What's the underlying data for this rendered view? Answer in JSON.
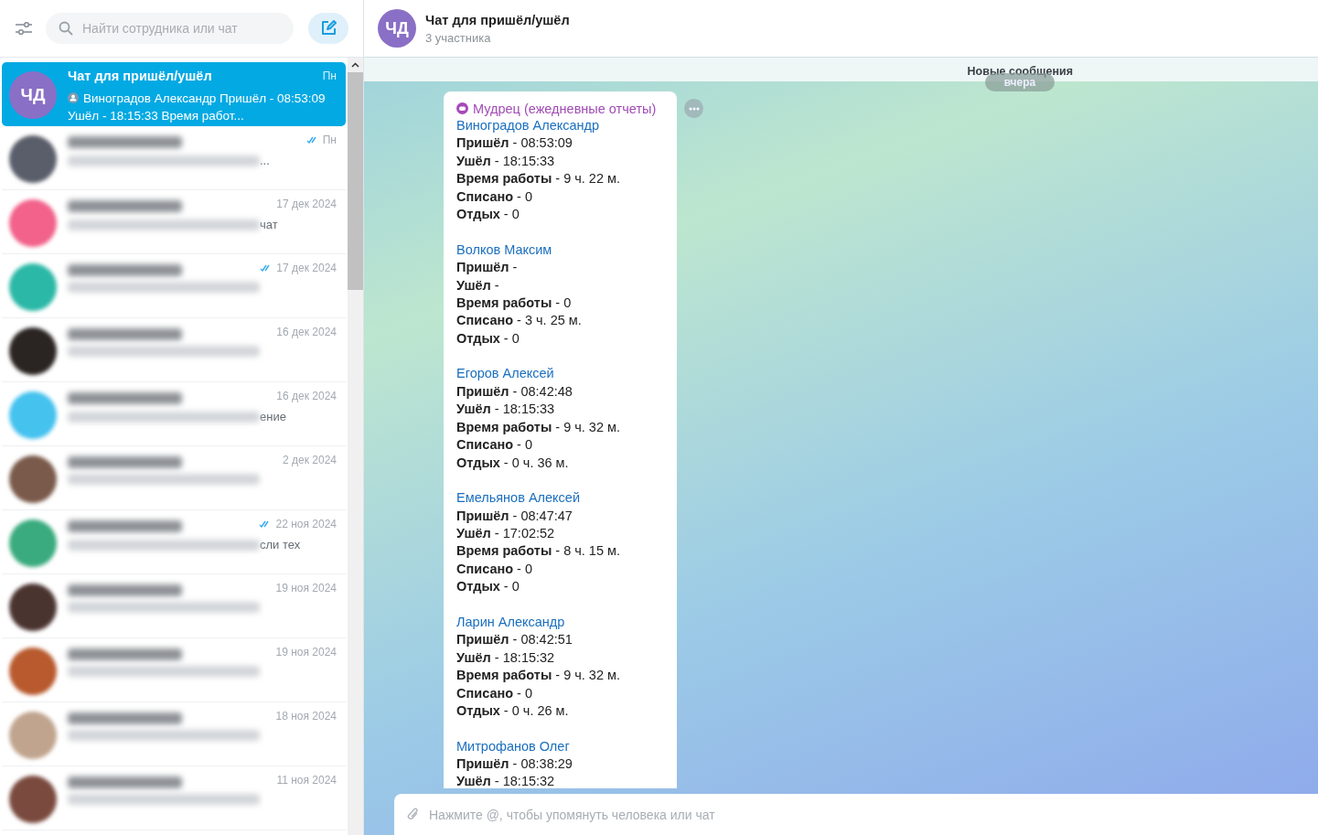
{
  "sidebar": {
    "search": {
      "placeholder": "Найти сотрудника или чат"
    },
    "chats": [
      {
        "avatar_text": "ЧД",
        "color": "#8a6fc6",
        "title": "Чат для пришёл/ушёл",
        "preview": "Виноградов Александр Пришёл - 08:53:09 Ушёл - 18:15:33 Время работ...",
        "time": "Пн",
        "selected": true,
        "blurred": false,
        "read": false
      },
      {
        "color": "#5a5e6a",
        "preview_tail": "...",
        "time": "Пн",
        "selected": false,
        "blurred": true,
        "read": true
      },
      {
        "color": "#f2628a",
        "preview_tail": "чат",
        "time": "17 дек 2024",
        "selected": false,
        "blurred": true,
        "read": false
      },
      {
        "color": "#2bb8a6",
        "time": "17 дек 2024",
        "selected": false,
        "blurred": true,
        "read": true
      },
      {
        "color": "#2a2422",
        "time": "16 дек 2024",
        "selected": false,
        "blurred": true,
        "read": false
      },
      {
        "color": "#45c2ee",
        "preview_tail": "ение",
        "time": "16 дек 2024",
        "selected": false,
        "blurred": true,
        "read": false
      },
      {
        "color": "#7a5a4a",
        "time": "2 дек 2024",
        "selected": false,
        "blurred": true,
        "read": false
      },
      {
        "color": "#3aab7e",
        "preview_tail": "сли тех",
        "time": "22 ноя 2024",
        "selected": false,
        "blurred": true,
        "read": true
      },
      {
        "color": "#4a3430",
        "time": "19 ноя 2024",
        "selected": false,
        "blurred": true,
        "read": false
      },
      {
        "color": "#b85a2e",
        "time": "19 ноя 2024",
        "selected": false,
        "blurred": true,
        "read": false
      },
      {
        "color": "#c0a48e",
        "time": "18 ноя 2024",
        "selected": false,
        "blurred": true,
        "read": false
      },
      {
        "color": "#7a4a3e",
        "time": "11 ноя 2024",
        "selected": false,
        "blurred": true,
        "read": false
      }
    ]
  },
  "chat": {
    "avatar_text": "ЧД",
    "title": "Чат для пришёл/ушёл",
    "subtitle": "3 участника",
    "new_messages": "Новые сообщения",
    "date": "вчера",
    "message": {
      "sender": "Мудрец (ежедневные отчеты)",
      "entries": [
        {
          "name": "Виноградов Александр",
          "lines": [
            "**Пришёл** - 08:53:09",
            "**Ушёл** - 18:15:33",
            "**Время работы** - 9 ч. 22 м.",
            "**Списано** - 0",
            "**Отдых** - 0"
          ]
        },
        {
          "name": "Волков Максим",
          "lines": [
            "**Пришёл** -",
            "**Ушёл** -",
            "**Время работы** - 0",
            "**Списано** - 3 ч. 25 м.",
            "**Отдых** - 0"
          ]
        },
        {
          "name": "Егоров Алексей",
          "lines": [
            "**Пришёл** - 08:42:48",
            "**Ушёл** - 18:15:33",
            "**Время работы** - 9 ч. 32 м.",
            "**Списано** - 0",
            "**Отдых** - 0 ч. 36 м."
          ]
        },
        {
          "name": "Емельянов Алексей",
          "lines": [
            "**Пришёл** - 08:47:47",
            "**Ушёл** - 17:02:52",
            "**Время работы** - 8 ч. 15 м.",
            "**Списано** - 0",
            "**Отдых** - 0"
          ]
        },
        {
          "name": "Ларин Александр",
          "lines": [
            "**Пришёл** - 08:42:51",
            "**Ушёл** - 18:15:32",
            "**Время работы** - 9 ч. 32 м.",
            "**Списано** - 0",
            "**Отдых** - 0 ч. 26 м."
          ]
        },
        {
          "name": "Митрофанов Олег",
          "lines": [
            "**Пришёл** - 08:38:29",
            "**Ушёл** - 18:15:32"
          ]
        }
      ]
    },
    "composer": {
      "placeholder": "Нажмите @, чтобы упомянуть человека или чат"
    }
  }
}
